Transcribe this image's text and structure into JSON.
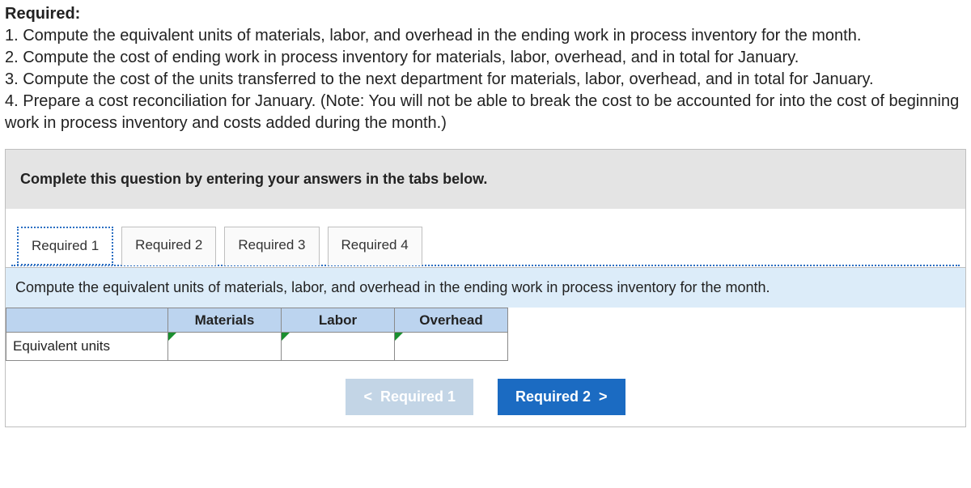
{
  "heading": "Required:",
  "prompt_lines": {
    "l1": "1. Compute the equivalent units of materials, labor, and overhead in the ending work in process inventory for the month.",
    "l2": "2. Compute the cost of ending work in process inventory for materials, labor, overhead, and in total for January.",
    "l3": "3. Compute the cost of the units transferred to the next department for materials, labor, overhead, and in total for January.",
    "l4": "4. Prepare a cost reconciliation for January. (Note: You will not be able to break the cost to be accounted for into the cost of beginning work in process inventory and costs added during the month.)"
  },
  "instruction": "Complete this question by entering your answers in the tabs below.",
  "tabs": {
    "t1": "Required 1",
    "t2": "Required 2",
    "t3": "Required 3",
    "t4": "Required 4"
  },
  "subprompt": "Compute the equivalent units of materials, labor, and overhead in the ending work in process inventory for the month.",
  "table": {
    "cols": {
      "c1": "Materials",
      "c2": "Labor",
      "c3": "Overhead"
    },
    "row_label": "Equivalent units",
    "values": {
      "materials": "",
      "labor": "",
      "overhead": ""
    }
  },
  "nav": {
    "prev": "Required 1",
    "next": "Required 2"
  },
  "icons": {
    "chev_left": "<",
    "chev_right": ">"
  }
}
